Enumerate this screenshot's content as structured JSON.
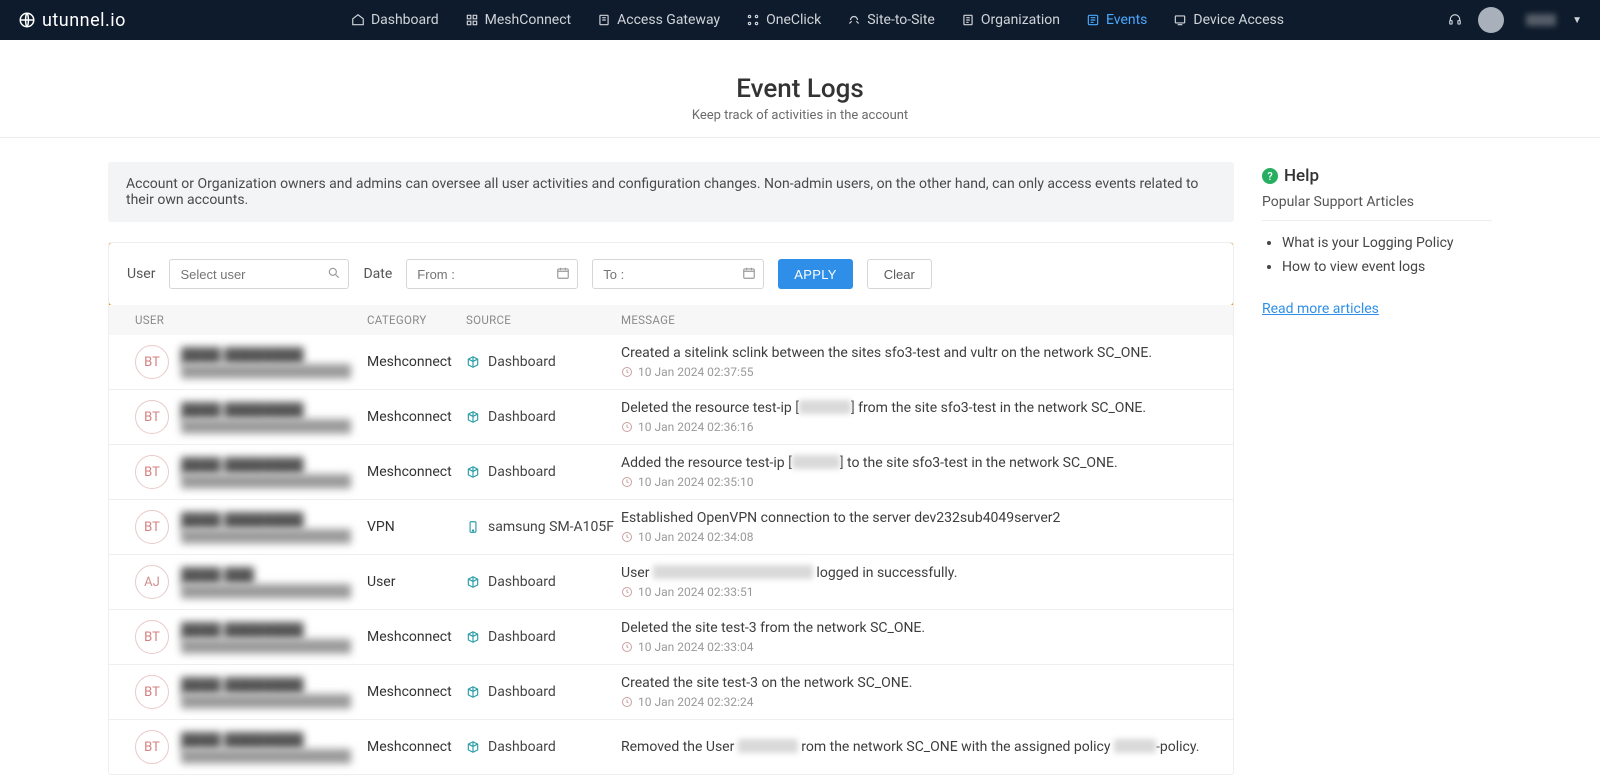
{
  "brand": "utunnel.io",
  "nav": {
    "items": [
      "Dashboard",
      "MeshConnect",
      "Access Gateway",
      "OneClick",
      "Site-to-Site",
      "Organization",
      "Events",
      "Device Access"
    ],
    "active_index": 6
  },
  "page": {
    "title": "Event Logs",
    "subtitle": "Keep track of activities in the account",
    "info": "Account or Organization owners and admins can oversee all user activities and configuration changes. Non-admin users, on the other hand, can only access events related to their own accounts."
  },
  "filter": {
    "user_label": "User",
    "user_placeholder": "Select user",
    "date_label": "Date",
    "from_placeholder": "From :",
    "to_placeholder": "To :",
    "apply": "APPLY",
    "clear": "Clear"
  },
  "columns": {
    "user": "USER",
    "category": "CATEGORY",
    "source": "SOURCE",
    "message": "MESSAGE"
  },
  "rows": [
    {
      "badge": "BT",
      "name": "████ ████████",
      "email": "████████████████████",
      "category": "Meshconnect",
      "source": "Dashboard",
      "src_icon": "cube",
      "message": "Created a sitelink sclink between the sites sfo3-test and vultr on the network SC_ONE.",
      "ts": "10 Jan 2024 02:37:55"
    },
    {
      "badge": "BT",
      "name": "████ ████████",
      "email": "████████████████████",
      "category": "Meshconnect",
      "source": "Dashboard",
      "src_icon": "cube",
      "message_html": "Deleted the resource test-ip [<span class='redact' style='width:52px'></span>] from the site sfo3-test in the network SC_ONE.",
      "ts": "10 Jan 2024 02:36:16"
    },
    {
      "badge": "BT",
      "name": "████ ████████",
      "email": "████████████████████",
      "category": "Meshconnect",
      "source": "Dashboard",
      "src_icon": "cube",
      "message_html": "Added the resource test-ip [<span class='redact' style='width:48px'></span>] to the site sfo3-test in the network SC_ONE.",
      "ts": "10 Jan 2024 02:35:10"
    },
    {
      "badge": "BT",
      "name": "████ ████████",
      "email": "████████████████████",
      "category": "VPN",
      "source": "samsung SM-A105F",
      "src_icon": "phone",
      "message": "Established OpenVPN connection to the server dev232sub4049server2",
      "ts": "10 Jan 2024 02:34:08"
    },
    {
      "badge": "AJ",
      "name": "████ ███",
      "email": "████████████████████",
      "category": "User",
      "source": "Dashboard",
      "src_icon": "cube",
      "message_html": "User <span class='redact' style='width:160px'></span> logged in successfully.",
      "ts": "10 Jan 2024 02:33:51"
    },
    {
      "badge": "BT",
      "name": "████ ████████",
      "email": "████████████████████",
      "category": "Meshconnect",
      "source": "Dashboard",
      "src_icon": "cube",
      "message": "Deleted the site test-3 from the network SC_ONE.",
      "ts": "10 Jan 2024 02:33:04"
    },
    {
      "badge": "BT",
      "name": "████ ████████",
      "email": "████████████████████",
      "category": "Meshconnect",
      "source": "Dashboard",
      "src_icon": "cube",
      "message": "Created the site test-3 on the network SC_ONE.",
      "ts": "10 Jan 2024 02:32:24"
    },
    {
      "badge": "BT",
      "name": "████ ████████",
      "email": "████████████████████",
      "category": "Meshconnect",
      "source": "Dashboard",
      "src_icon": "cube",
      "message_html": "Removed the User <span class='redact' style='width:60px'></span> rom the network SC_ONE with the assigned policy <span class='redact' style='width:42px'></span>-policy.",
      "ts": ""
    }
  ],
  "help": {
    "title": "Help",
    "subtitle": "Popular Support Articles",
    "links": [
      "What is your Logging Policy",
      "How to view event logs"
    ],
    "more": "Read more articles"
  }
}
